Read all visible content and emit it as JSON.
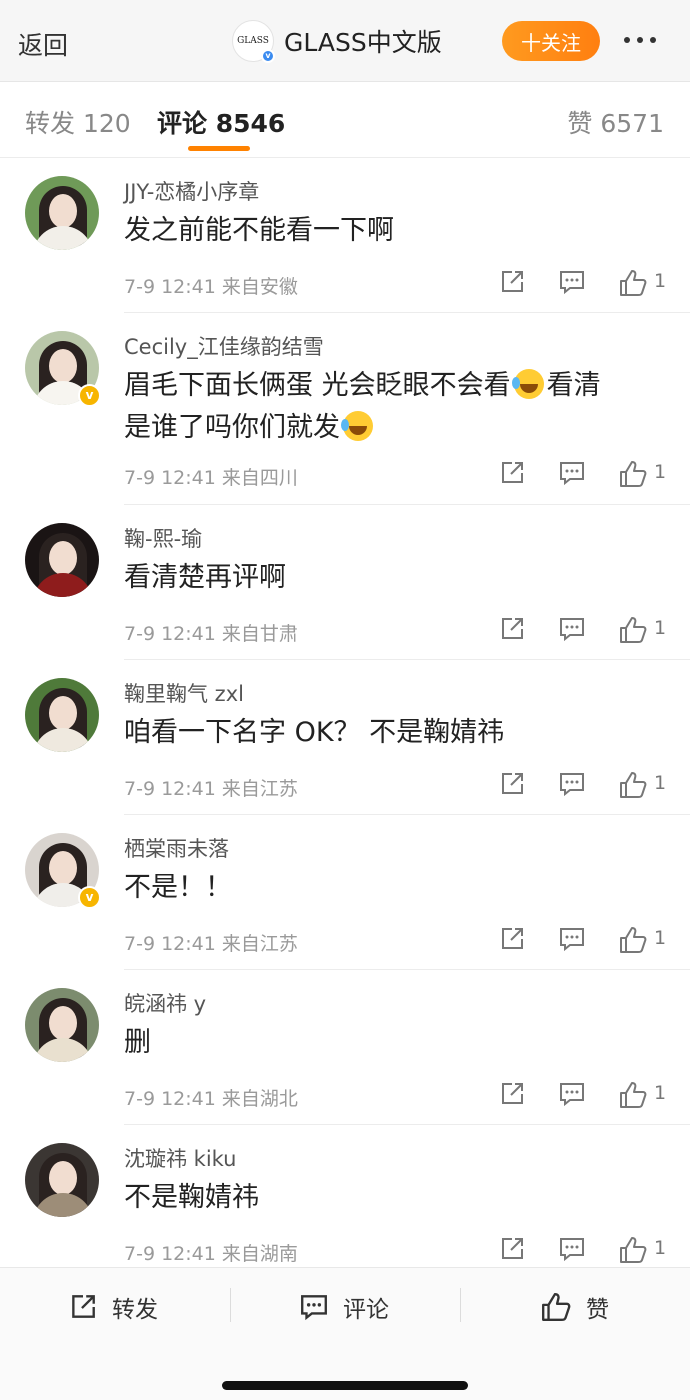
{
  "header": {
    "back_label": "返回",
    "brand_logo_text": "GLASS",
    "brand_name": "GLASS中文版",
    "follow_label": "十关注"
  },
  "tabs": {
    "repost": "转发 120",
    "comment": "评论 8546",
    "like": "赞 6571"
  },
  "colors": {
    "accent": "#ff8200",
    "verify_gold": "#f7b500",
    "verify_blue": "#3a8bf0"
  },
  "comments": [
    {
      "username": "JJY-恋橘小序章",
      "text": "发之前能不能看一下啊",
      "time": "7-9 12:41 来自安徽",
      "likes": "1",
      "verified": false
    },
    {
      "username": "Cecily_江佳缘韵结雪",
      "text_1": "眉毛下面长俩蛋 光会眨眼不会看",
      "text_2": "看清",
      "text_3": "是谁了吗你们就发",
      "time": "7-9 12:41 来自四川",
      "likes": "1",
      "verified": true
    },
    {
      "username": "鞠-熙-瑜",
      "text": "看清楚再评啊",
      "time": "7-9 12:41 来自甘肃",
      "likes": "1",
      "verified": false
    },
    {
      "username": "鞠里鞠气 zxl",
      "text": "咱看一下名字 OK？ 不是鞠婧祎",
      "time": "7-9 12:41 来自江苏",
      "likes": "1",
      "verified": false
    },
    {
      "username": "栖棠雨未落",
      "text": "不是！！",
      "time": "7-9 12:41 来自江苏",
      "likes": "1",
      "verified": true
    },
    {
      "username": "皖涵祎 y",
      "text": "删",
      "time": "7-9 12:41 来自湖北",
      "likes": "1",
      "verified": false
    },
    {
      "username": "沈璇祎 kiku",
      "text": "不是鞠婧祎",
      "time": "7-9 12:41 来自湖南",
      "likes": "1",
      "verified": false
    }
  ],
  "icons": {
    "repost": "share-icon",
    "comment": "comment-icon",
    "like": "thumbs-up-icon",
    "emoji": "laughing-crying-emoji",
    "more": "more-dots-icon"
  },
  "bottom_bar": {
    "repost_label": "转发",
    "comment_label": "评论",
    "like_label": "赞"
  }
}
